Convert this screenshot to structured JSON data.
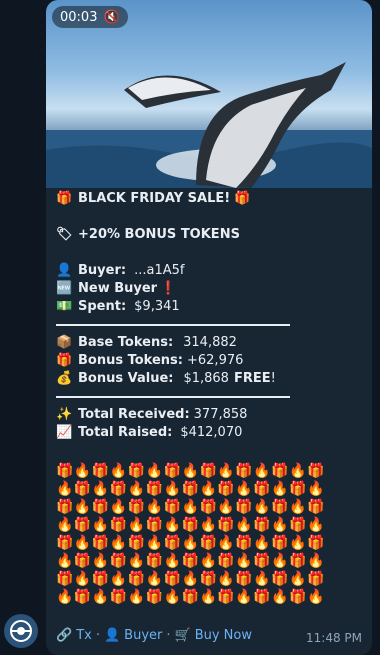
{
  "video": {
    "time": "00:03",
    "mute_icon": "speaker-muted-icon"
  },
  "sale": {
    "title": "BLACK FRIDAY SALE!",
    "bonus": "+20% BONUS TOKENS",
    "buyer_label": "Buyer:",
    "buyer_value": "...a1A5f",
    "new_buyer": "New Buyer",
    "spent_label": "Spent:",
    "spent_value": "$9,341",
    "base_label": "Base Tokens:",
    "base_value": "314,882",
    "bonus_tokens_label": "Bonus Tokens:",
    "bonus_tokens_value": "+62,976",
    "bonus_value_label": "Bonus Value:",
    "bonus_value_amount": "$1,868",
    "free_text": "FREE",
    "bang": "!",
    "received_label": "Total Received:",
    "received_value": "377,858",
    "raised_label": "Total Raised:",
    "raised_value": "$412,070"
  },
  "emoji_grid": [
    "🎁🔥🎁🔥🎁🔥🎁🔥🎁🔥🎁🔥🎁🔥🎁",
    "🔥🎁🔥🎁🔥🎁🔥🎁🔥🎁🔥🎁🔥🎁🔥",
    "🎁🔥🎁🔥🎁🔥🎁🔥🎁🔥🎁🔥🎁🔥🎁",
    "🔥🎁🔥🎁🔥🎁🔥🎁🔥🎁🔥🎁🔥🎁🔥",
    "🎁🔥🎁🔥🎁🔥🎁🔥🎁🔥🎁🔥🎁🔥🎁",
    "🔥🎁🔥🎁🔥🎁🔥🎁🔥🎁🔥🎁🔥🎁🔥",
    "🎁🔥🎁🔥🎁🔥🎁🔥🎁🔥🎁🔥🎁🔥🎁",
    "🔥🎁🔥🎁🔥🎁🔥🎁🔥🎁🔥🎁🔥🎁🔥"
  ],
  "footer": {
    "tx_label": "Tx",
    "buyer_label": "Buyer",
    "buy_now_label": "Buy Now",
    "dot": "·",
    "time": "11:48 PM"
  },
  "colors": {
    "link": "#6ab3f3",
    "bubble": "#182533",
    "background": "#0e1621"
  }
}
